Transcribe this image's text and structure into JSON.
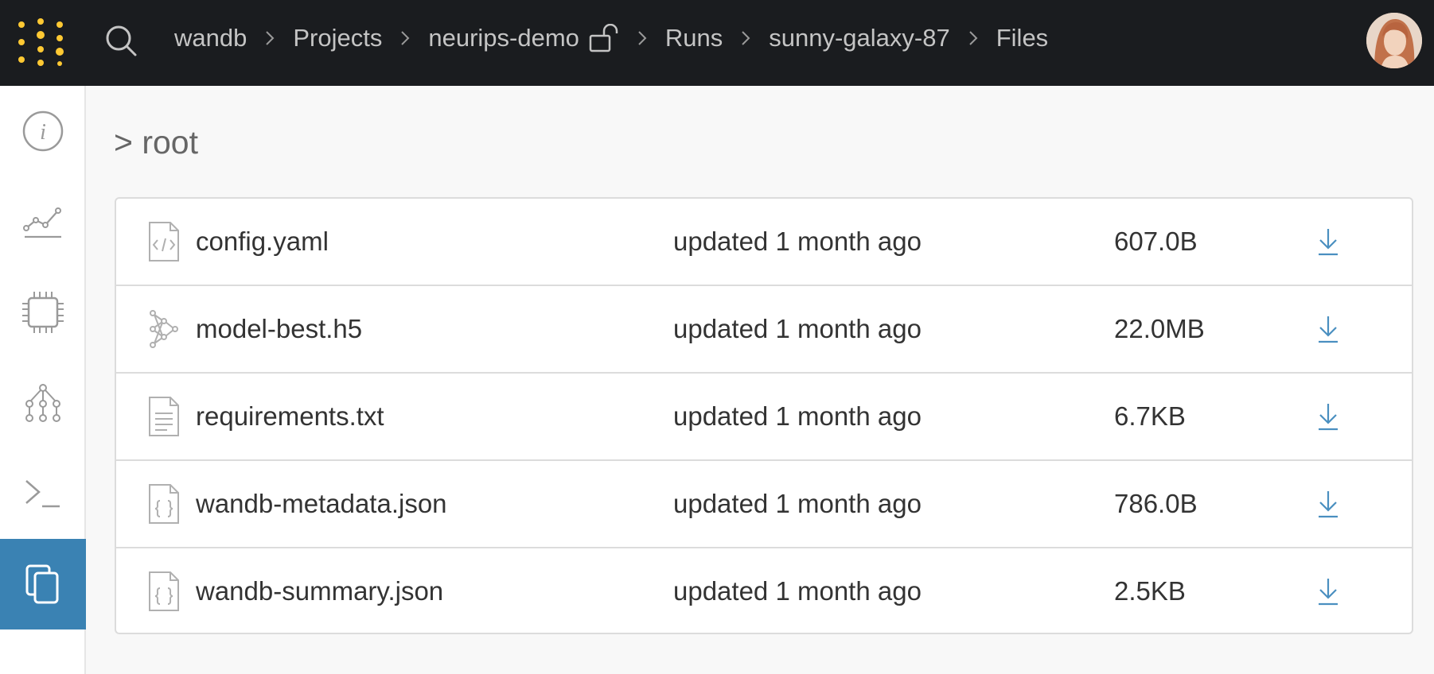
{
  "header": {
    "logo_icon": "wandb-dots-logo",
    "search_icon": "search-icon",
    "breadcrumb": [
      {
        "label": "wandb"
      },
      {
        "label": "Projects"
      },
      {
        "label": "neurips-demo",
        "icon": "unlocked-lock-icon"
      },
      {
        "label": "Runs"
      },
      {
        "label": "sunny-galaxy-87"
      },
      {
        "label": "Files"
      }
    ],
    "avatar_icon": "user-avatar"
  },
  "sidebar": {
    "items": [
      {
        "icon": "info-icon",
        "active": false
      },
      {
        "icon": "line-chart-icon",
        "active": false
      },
      {
        "icon": "cpu-chip-icon",
        "active": false
      },
      {
        "icon": "model-graph-icon",
        "active": false
      },
      {
        "icon": "terminal-icon",
        "active": false
      },
      {
        "icon": "files-icon",
        "active": true
      }
    ]
  },
  "main": {
    "path_title": "> root",
    "files": [
      {
        "name": "config.yaml",
        "updated": "updated 1 month ago",
        "size": "607.0B",
        "icon": "code-file-icon"
      },
      {
        "name": "model-best.h5",
        "updated": "updated 1 month ago",
        "size": "22.0MB",
        "icon": "neural-network-icon"
      },
      {
        "name": "requirements.txt",
        "updated": "updated 1 month ago",
        "size": "6.7KB",
        "icon": "text-file-icon"
      },
      {
        "name": "wandb-metadata.json",
        "updated": "updated 1 month ago",
        "size": "786.0B",
        "icon": "json-file-icon"
      },
      {
        "name": "wandb-summary.json",
        "updated": "updated 1 month ago",
        "size": "2.5KB",
        "icon": "json-file-icon"
      }
    ]
  },
  "colors": {
    "topbar": "#1a1c1f",
    "logo_yellow": "#ffc933",
    "accent_blue": "#3a82b3",
    "link_blue": "#4a8fc0"
  }
}
